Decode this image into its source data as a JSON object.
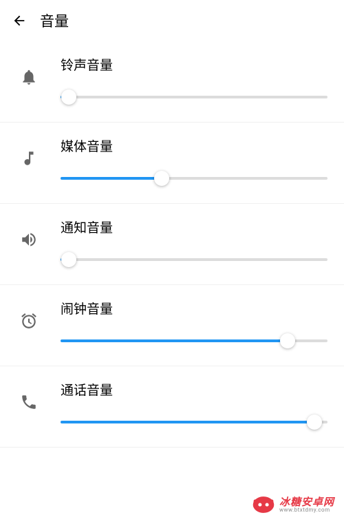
{
  "header": {
    "title": "音量"
  },
  "sliders": {
    "ringtone": {
      "label": "铃声音量",
      "value": 3
    },
    "media": {
      "label": "媒体音量",
      "value": 38
    },
    "notification": {
      "label": "通知音量",
      "value": 3
    },
    "alarm": {
      "label": "闹钟音量",
      "value": 85
    },
    "call": {
      "label": "通话音量",
      "value": 95
    }
  },
  "watermark": {
    "main": "冰糖安卓网",
    "sub": "www.btxtdmy.com"
  },
  "colors": {
    "accent": "#2196f3",
    "track": "#dcdcdc",
    "watermark": "#e63946"
  }
}
